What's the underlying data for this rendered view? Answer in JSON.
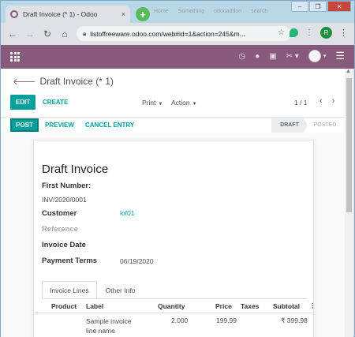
{
  "browser": {
    "tab_title": "Draft Invoice (* 1) - Odoo",
    "tab_close": "×",
    "new_tab": "+",
    "ghost_tabs": [
      "Home",
      "Something",
      "odooaddon",
      "search"
    ],
    "window_controls": {
      "minimize": "–",
      "restore": "❐",
      "close": "✕"
    },
    "url": "listoffreeware.odoo.com/web#id=1&action=245&m...",
    "profile_initial": "R"
  },
  "control_panel": {
    "breadcrumb": "Draft Invoice (* 1)",
    "edit_label": "EDIT",
    "create_label": "CREATE",
    "print_label": "Print",
    "action_label": "Action",
    "pager": "1 / 1"
  },
  "statusbar": {
    "post_label": "POST",
    "preview_label": "PREVIEW",
    "cancel_label": "CANCEL ENTRY",
    "stages": [
      "DRAFT",
      "POSTED"
    ],
    "active_stage": "DRAFT"
  },
  "sheet": {
    "title": "Draft Invoice",
    "first_number_label": "First Number:",
    "first_number_value": "INV/2020/0001",
    "customer_label": "Customer",
    "customer_value": "lof01",
    "reference_label": "Reference",
    "invoice_date_label": "Invoice Date",
    "payment_terms_label": "Payment Terms",
    "payment_terms_value": "06/19/2020"
  },
  "notebook": {
    "tabs": [
      "Invoice Lines",
      "Other Info"
    ],
    "active_tab": "Invoice Lines"
  },
  "invoice_lines": {
    "columns": [
      "Product",
      "Label",
      "Quantity",
      "Price",
      "Taxes",
      "Subtotal"
    ],
    "rows": [
      {
        "product": "",
        "label": "Sample invoice line name",
        "quantity": "2.000",
        "price": "199.99",
        "taxes": "",
        "subtotal": "₹ 399.98"
      }
    ]
  },
  "colors": {
    "odoo_purple": "#875a7b",
    "teal": "#00a09d"
  }
}
